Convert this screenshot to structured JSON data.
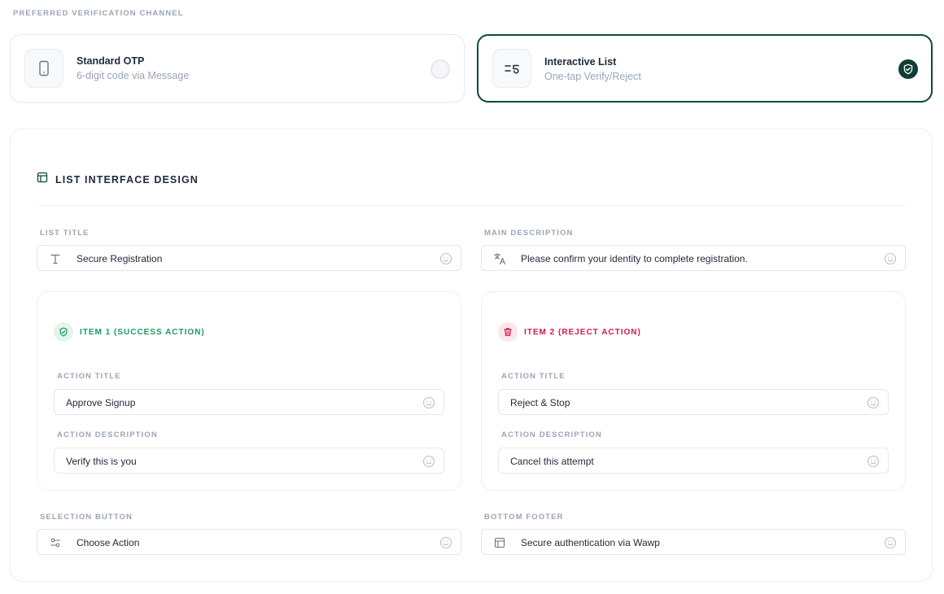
{
  "channel": {
    "heading": "PREFERRED VERIFICATION CHANNEL",
    "options": [
      {
        "title": "Standard OTP",
        "subtitle": "6-digit code via Message",
        "icon": "phone-icon",
        "selected": false
      },
      {
        "title": "Interactive List",
        "subtitle": "One-tap Verify/Reject",
        "icon": "list-icon",
        "selected": true
      }
    ]
  },
  "design": {
    "title": "LIST INTERFACE DESIGN",
    "list_title": {
      "label": "LIST TITLE",
      "value": "Secure Registration"
    },
    "main_description": {
      "label": "MAIN DESCRIPTION",
      "value": "Please confirm your identity to complete registration."
    },
    "item1": {
      "title": "ITEM 1 (SUCCESS ACTION)",
      "action_title_label": "ACTION TITLE",
      "action_title": "Approve Signup",
      "action_desc_label": "ACTION DESCRIPTION",
      "action_desc": "Verify this is you"
    },
    "item2": {
      "title": "ITEM 2 (REJECT ACTION)",
      "action_title_label": "ACTION TITLE",
      "action_title": "Reject & Stop",
      "action_desc_label": "ACTION DESCRIPTION",
      "action_desc": "Cancel this attempt"
    },
    "selection_button": {
      "label": "SELECTION BUTTON",
      "value": "Choose Action"
    },
    "bottom_footer": {
      "label": "BOTTOM FOOTER",
      "value": "Secure authentication via Wawp"
    }
  },
  "colors": {
    "accent": "#0f4a42",
    "success": "#1a9a5c",
    "reject": "#d11a48",
    "muted": "#9aa5b4"
  }
}
